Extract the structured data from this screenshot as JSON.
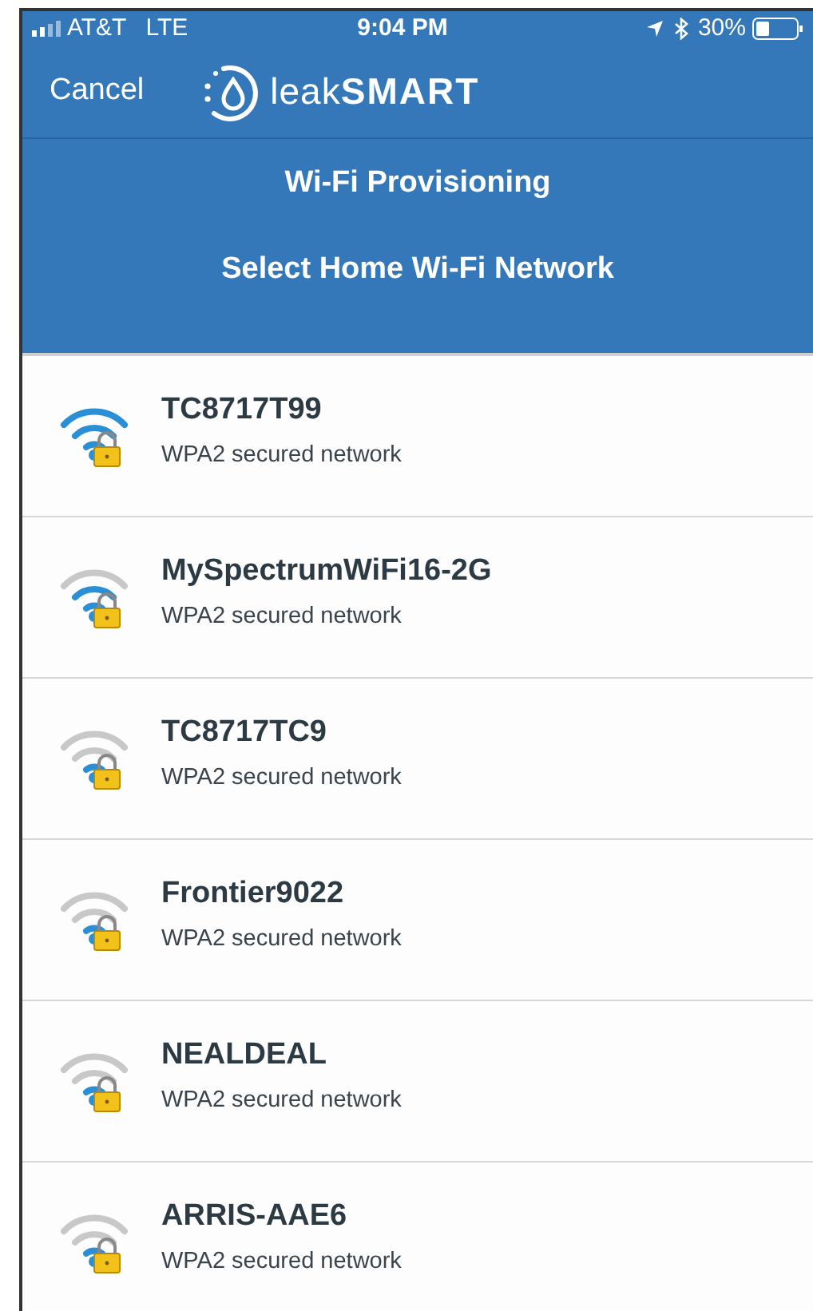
{
  "status_bar": {
    "carrier": "AT&T",
    "network": "LTE",
    "time": "9:04 PM",
    "battery": "30%"
  },
  "nav": {
    "cancel": "Cancel",
    "logo_light": "leak",
    "logo_bold": "SMART"
  },
  "header": {
    "title": "Wi-Fi Provisioning",
    "subtitle": "Select Home Wi-Fi Network"
  },
  "networks": [
    {
      "name": "TC8717T99",
      "security": "WPA2 secured network",
      "kind": "strong"
    },
    {
      "name": "MySpectrumWiFi16-2G",
      "security": "WPA2 secured network",
      "kind": "medium"
    },
    {
      "name": "TC8717TC9",
      "security": "WPA2 secured network",
      "kind": "weak"
    },
    {
      "name": "Frontier9022",
      "security": "WPA2 secured network",
      "kind": "weak"
    },
    {
      "name": "NEALDEAL",
      "security": "WPA2 secured network",
      "kind": "weak"
    },
    {
      "name": "ARRIS-AAE6",
      "security": "WPA2 secured network",
      "kind": "weak"
    }
  ]
}
